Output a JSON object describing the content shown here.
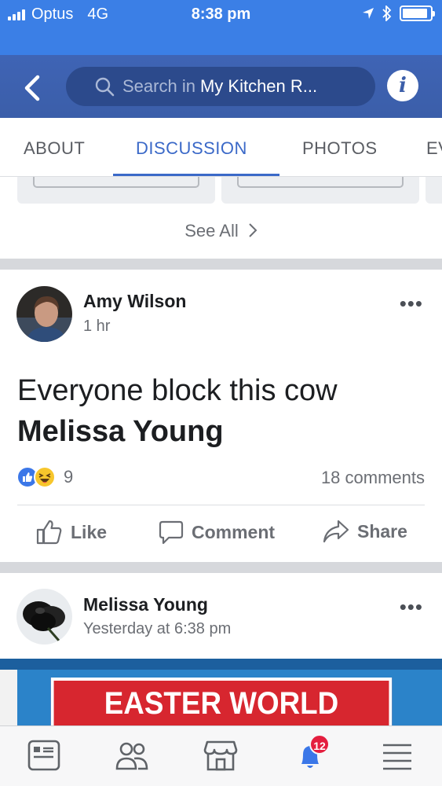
{
  "status_bar": {
    "carrier": "Optus",
    "network": "4G",
    "time": "8:38 pm",
    "battery_level": 0.92
  },
  "nav": {
    "search_placeholder": "Search in",
    "search_group": "My Kitchen R...",
    "info_label": "i"
  },
  "tabs": [
    {
      "label": "ABOUT"
    },
    {
      "label": "DISCUSSION",
      "active": true
    },
    {
      "label": "PHOTOS"
    },
    {
      "label": "EV"
    }
  ],
  "see_all": {
    "label": "See All"
  },
  "posts": [
    {
      "author": "Amy Wilson",
      "time": "1 hr",
      "text": "Everyone block this cow",
      "mention": "Melissa Young",
      "reaction_count": "9",
      "comments": "18 comments",
      "actions": {
        "like": "Like",
        "comment": "Comment",
        "share": "Share"
      }
    },
    {
      "author": "Melissa Young",
      "time": "Yesterday at 6:38 pm",
      "image_text": "EASTER WORLD RECORD"
    }
  ],
  "bottom_bar": {
    "items": [
      "news-feed-icon",
      "groups-icon",
      "marketplace-icon",
      "notifications-icon",
      "menu-icon"
    ],
    "badge": "12"
  },
  "colors": {
    "brand": "#3b5ea9",
    "status_bar": "#3b7fe6",
    "active_tab": "#3b69c8",
    "badge": "#e41e3f"
  }
}
